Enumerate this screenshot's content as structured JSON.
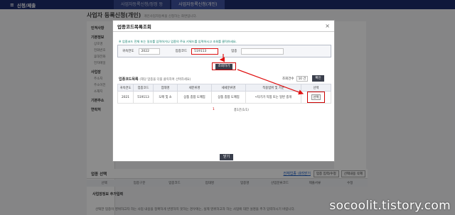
{
  "topbar": {
    "menu_label": "신청/제출",
    "tabs": [
      "사업자등록신청/정정 등",
      "사업자등록신청(개인)"
    ]
  },
  "page": {
    "title": "사업자 등록신청(개인)",
    "subtitle": "개인사업자등록을 신청하는 화면입니다."
  },
  "left_sections": [
    {
      "heading": "인적사항",
      "items": []
    },
    {
      "heading": "기본정보",
      "items": [
        "상호명",
        "전화번호",
        "휴대전화",
        "전자메일"
      ]
    },
    {
      "heading": "사업장",
      "items": [
        "주소지",
        "주소이전",
        "소재지"
      ]
    },
    {
      "heading": "기본주소",
      "items": []
    },
    {
      "heading": "연락처",
      "items": []
    }
  ],
  "bottom": {
    "section_title": "업종 선택",
    "link_label": "전체업종 내려받기",
    "button_edit": "업종 입력/수정",
    "button_delete": "선택내용 삭제",
    "columns": [
      "선택",
      "업종구분",
      "업종코드",
      "업태명",
      "업종명",
      "산업분류코드",
      "제출서류",
      "수정"
    ],
    "note_title": "사업장정보 추가입력",
    "note_text": "선택한 업종이 영위하고자 하는 사업 내용을 정확하게 반영하지 못하는 경우에는, 실제 영위하고자 하는 사업에 대한 설명을 추가 입력하시기 바랍니다."
  },
  "modal": {
    "title": "업종코드목록조회",
    "notice": "※ 업종코드 전체 또는 일부를 입력하거나 업종의 주요 키워드를 입력하시고 조회를 클릭하세요.",
    "search": {
      "year_label": "귀속연도",
      "year_value": "2022",
      "code_label": "업종코드",
      "code_value": "519113",
      "industry_label": "업종",
      "industry_value": ""
    },
    "search_button": "조회하기",
    "result_title": "업종코드목록",
    "result_hint": "(해당 업종을 더블 클릭하여 선택하세요)",
    "per_page_label": "조회건수",
    "per_page_value": "10 건",
    "confirm_button": "확인",
    "table": {
      "headers": [
        "귀속연도",
        "업종코드",
        "업태명",
        "세분류명",
        "세세분류명",
        "적용범위 및 기준",
        "선택"
      ],
      "rows": [
        {
          "year": "2021",
          "code": "519113",
          "biz_type": "도매 및 소",
          "sub": "상품 종합 도매업",
          "subsub": "상품 종합 도매업",
          "scope": "•자기가 직접 또는 일반 중개",
          "select": "선택"
        }
      ]
    },
    "page_current": "1",
    "total": "총1건(1/1)",
    "close_button": "닫기"
  },
  "watermark": "socoolit.tistory.com",
  "colors": {
    "navy": "#1d2d6c",
    "highlight_red": "#cc0000",
    "notice_green": "#0b7b6a"
  }
}
